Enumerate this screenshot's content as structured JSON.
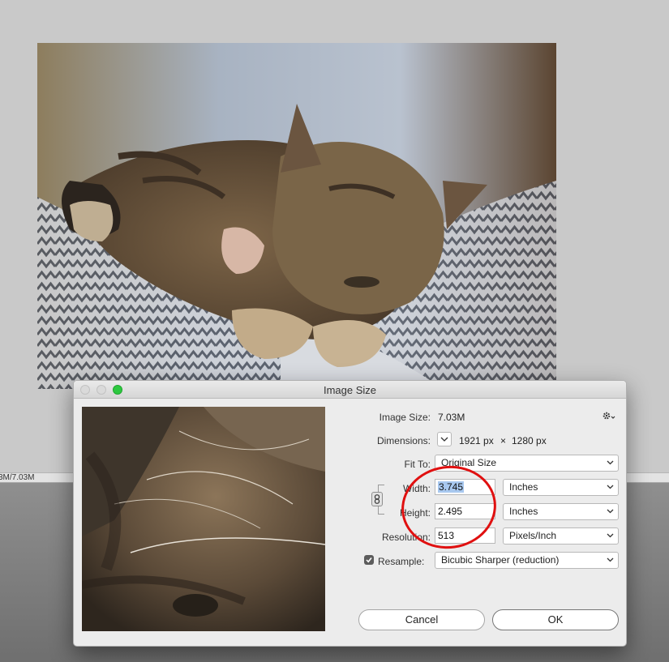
{
  "statusbar": {
    "doc_size": "3M/7.03M"
  },
  "dialog": {
    "title": "Image Size",
    "image_size_label": "Image Size:",
    "image_size_value": "7.03M",
    "dimensions_label": "Dimensions:",
    "dimensions_width": "1921 px",
    "dimensions_times": "×",
    "dimensions_height": "1280 px",
    "fit_to_label": "Fit To:",
    "fit_to_value": "Original Size",
    "width_label": "Width:",
    "width_value": "3.745",
    "width_unit": "Inches",
    "height_label": "Height:",
    "height_value": "2.495",
    "height_unit": "Inches",
    "resolution_label": "Resolution:",
    "resolution_value": "513",
    "resolution_unit": "Pixels/Inch",
    "resample_label": "Resample:",
    "resample_checked": true,
    "resample_value": "Bicubic Sharper (reduction)",
    "cancel_label": "Cancel",
    "ok_label": "OK"
  },
  "icons": {
    "settings": "gear-icon",
    "constrain": "chain-link-icon",
    "dropdown": "chevron-down-icon"
  },
  "colors": {
    "annotation": "#e01010",
    "maximize": "#2dc840",
    "selection": "#a8c8ef"
  }
}
